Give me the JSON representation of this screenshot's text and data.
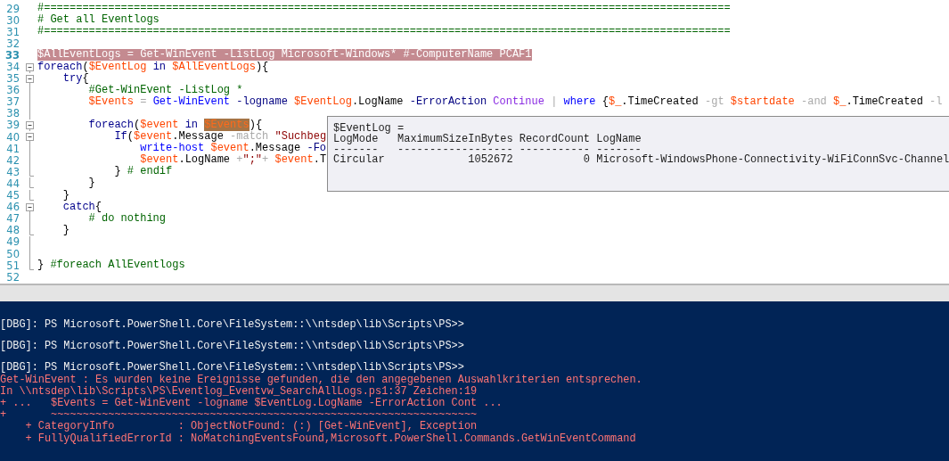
{
  "editor": {
    "lines": [
      {
        "number": "29",
        "kind": "code",
        "selected": false,
        "tokens": [
          {
            "kind": "comment",
            "text": "#==========================================================================================================="
          }
        ]
      },
      {
        "number": "30",
        "kind": "code",
        "selected": false,
        "tokens": [
          {
            "kind": "comment",
            "text": "# Get all Eventlogs"
          }
        ]
      },
      {
        "number": "31",
        "kind": "code",
        "selected": false,
        "tokens": [
          {
            "kind": "comment",
            "text": "#==========================================================================================================="
          }
        ]
      },
      {
        "number": "32",
        "kind": "code",
        "selected": false
      },
      {
        "number": "33",
        "kind": "code",
        "selected": true,
        "tokens": [
          {
            "kind": "variable",
            "text": "$AllEventLogs "
          },
          {
            "kind": "plain",
            "text": "= "
          },
          {
            "kind": "cmdlet",
            "text": "Get-WinEvent "
          },
          {
            "kind": "param",
            "text": "-ListLog "
          },
          {
            "kind": "plain",
            "text": "Microsoft-Windows* "
          },
          {
            "kind": "comment",
            "text": "#-ComputerName PCAF1"
          }
        ]
      },
      {
        "number": "34",
        "kind": "fold-start",
        "selected": false,
        "tokens": [
          {
            "kind": "keyword",
            "text": "foreach"
          },
          {
            "kind": "plain",
            "text": "("
          },
          {
            "kind": "variable",
            "text": "$EventLog "
          },
          {
            "kind": "keyword",
            "text": "in "
          },
          {
            "kind": "variable",
            "text": "$AllEventLogs"
          },
          {
            "kind": "plain",
            "text": "){"
          }
        ]
      },
      {
        "number": "35",
        "kind": "fold-start",
        "selected": false,
        "tokens": [
          {
            "kind": "keyword",
            "text": "    try"
          },
          {
            "kind": "plain",
            "text": "{"
          }
        ]
      },
      {
        "number": "36",
        "kind": "fold-guide",
        "selected": false,
        "tokens": [
          {
            "kind": "comment",
            "text": "        #Get-WinEvent -ListLog *"
          }
        ]
      },
      {
        "number": "37",
        "kind": "fold-guide",
        "selected": false,
        "tokens": [
          {
            "kind": "variable",
            "text": "        $Events "
          },
          {
            "kind": "operator",
            "text": "= "
          },
          {
            "kind": "cmdlet",
            "text": "Get-WinEvent "
          },
          {
            "kind": "param",
            "text": "-logname "
          },
          {
            "kind": "variable",
            "text": "$EventLog"
          },
          {
            "kind": "plain",
            "text": ".LogName "
          },
          {
            "kind": "param",
            "text": "-ErrorAction "
          },
          {
            "kind": "enum",
            "text": "Continue "
          },
          {
            "kind": "operator",
            "text": "| "
          },
          {
            "kind": "cmdlet",
            "text": "where "
          },
          {
            "kind": "plain",
            "text": "{"
          },
          {
            "kind": "variable",
            "text": "$_"
          },
          {
            "kind": "plain",
            "text": ".TimeCreated "
          },
          {
            "kind": "operator",
            "text": "-gt "
          },
          {
            "kind": "variable",
            "text": "$startdate "
          },
          {
            "kind": "operator",
            "text": "-and "
          },
          {
            "kind": "variable",
            "text": "$_"
          },
          {
            "kind": "plain",
            "text": ".TimeCreated "
          },
          {
            "kind": "operator",
            "text": "-l"
          }
        ]
      },
      {
        "number": "38",
        "kind": "fold-guide",
        "selected": false
      },
      {
        "number": "39",
        "kind": "fold-start",
        "selected": false,
        "tokens": [
          {
            "kind": "keyword",
            "text": "        foreach"
          },
          {
            "kind": "plain",
            "text": "("
          },
          {
            "kind": "variable",
            "text": "$event "
          },
          {
            "kind": "keyword",
            "text": "in "
          },
          {
            "kind": "variable",
            "text": "$Events",
            "highlighted": true
          },
          {
            "kind": "plain",
            "text": "){"
          }
        ]
      },
      {
        "number": "40",
        "kind": "fold-start",
        "selected": false,
        "tokens": [
          {
            "kind": "keyword",
            "text": "            If"
          },
          {
            "kind": "plain",
            "text": "("
          },
          {
            "kind": "variable",
            "text": "$event"
          },
          {
            "kind": "plain",
            "text": ".Message "
          },
          {
            "kind": "operator",
            "text": "-match "
          },
          {
            "kind": "string",
            "text": "\"Suchbeg"
          }
        ]
      },
      {
        "number": "41",
        "kind": "fold-guide",
        "selected": false,
        "tokens": [
          {
            "kind": "cmdlet",
            "text": "                write-host "
          },
          {
            "kind": "variable",
            "text": "$event"
          },
          {
            "kind": "plain",
            "text": ".Message "
          },
          {
            "kind": "param",
            "text": "-Fo"
          }
        ]
      },
      {
        "number": "42",
        "kind": "fold-guide",
        "selected": false,
        "tokens": [
          {
            "kind": "variable",
            "text": "                $event"
          },
          {
            "kind": "plain",
            "text": ".LogName "
          },
          {
            "kind": "operator",
            "text": "+"
          },
          {
            "kind": "string",
            "text": "\";\""
          },
          {
            "kind": "operator",
            "text": "+ "
          },
          {
            "kind": "variable",
            "text": "$event"
          },
          {
            "kind": "plain",
            "text": ".T"
          }
        ]
      },
      {
        "number": "43",
        "kind": "fold-end",
        "selected": false,
        "tokens": [
          {
            "kind": "plain",
            "text": "            } "
          },
          {
            "kind": "comment",
            "text": "# endif"
          }
        ]
      },
      {
        "number": "44",
        "kind": "fold-end",
        "selected": false,
        "tokens": [
          {
            "kind": "plain",
            "text": "        }"
          }
        ]
      },
      {
        "number": "45",
        "kind": "fold-end",
        "selected": false,
        "tokens": [
          {
            "kind": "plain",
            "text": "    }"
          }
        ]
      },
      {
        "number": "46",
        "kind": "fold-start",
        "selected": false,
        "tokens": [
          {
            "kind": "keyword",
            "text": "    catch"
          },
          {
            "kind": "plain",
            "text": "{"
          }
        ]
      },
      {
        "number": "47",
        "kind": "fold-guide",
        "selected": false,
        "tokens": [
          {
            "kind": "comment",
            "text": "        # do nothing"
          }
        ]
      },
      {
        "number": "48",
        "kind": "fold-end",
        "selected": false,
        "tokens": [
          {
            "kind": "plain",
            "text": "    }"
          }
        ]
      },
      {
        "number": "49",
        "kind": "fold-guide",
        "selected": false
      },
      {
        "number": "50",
        "kind": "fold-guide",
        "selected": false
      },
      {
        "number": "51",
        "kind": "fold-end",
        "selected": false,
        "tokens": [
          {
            "kind": "plain",
            "text": "} "
          },
          {
            "kind": "comment",
            "text": "#foreach AllEventlogs"
          }
        ]
      },
      {
        "number": "52",
        "kind": "code",
        "selected": false
      }
    ],
    "tooltip": {
      "lines": [
        "$EventLog =",
        "LogMode   MaximumSizeInBytes RecordCount LogName",
        "-------   ------------------ ----------- -------",
        "Circular             1052672           0 Microsoft-WindowsPhone-Connectivity-WiFiConnSvc-Channel"
      ]
    }
  },
  "console": {
    "lines": [
      {
        "kind": "prompt",
        "text": "[DBG]: PS Microsoft.PowerShell.Core\\FileSystem::\\\\ntsdep\\lib\\Scripts\\PS>>"
      },
      {
        "kind": "prompt",
        "text": "[DBG]: PS Microsoft.PowerShell.Core\\FileSystem::\\\\ntsdep\\lib\\Scripts\\PS>>"
      },
      {
        "kind": "prompt",
        "text": "[DBG]: PS Microsoft.PowerShell.Core\\FileSystem::\\\\ntsdep\\lib\\Scripts\\PS>>"
      },
      {
        "kind": "error",
        "text": "Get-WinEvent : Es wurden keine Ereignisse gefunden, die den angegebenen Auswahlkriterien entsprechen."
      },
      {
        "kind": "error",
        "text": "In \\\\ntsdep\\lib\\Scripts\\PS\\Eventlog_Eventvw_SearchAllLogs.ps1:37 Zeichen:19"
      },
      {
        "kind": "error",
        "text": "+ ...   $Events = Get-WinEvent -logname $EventLog.LogName -ErrorAction Cont ..."
      },
      {
        "kind": "error",
        "text": "+       ~~~~~~~~~~~~~~~~~~~~~~~~~~~~~~~~~~~~~~~~~~~~~~~~~~~~~~~~~~~~~~~~~~~"
      },
      {
        "kind": "error",
        "text": "    + CategoryInfo          : ObjectNotFound: (:) [Get-WinEvent], Exception"
      },
      {
        "kind": "error",
        "text": "    + FullyQualifiedErrorId : NoMatchingEventsFound,Microsoft.PowerShell.Commands.GetWinEventCommand"
      }
    ]
  }
}
